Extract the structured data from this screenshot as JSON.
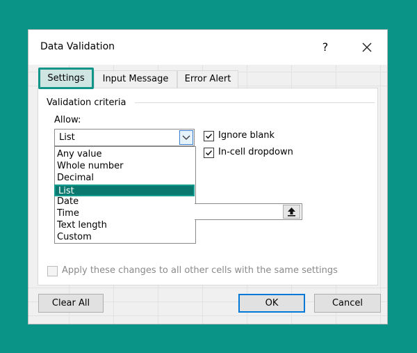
{
  "dialog": {
    "title": "Data Validation",
    "help": "?",
    "close_icon": "close-icon"
  },
  "tabs": [
    {
      "label": "Settings",
      "active": true
    },
    {
      "label": "Input Message",
      "active": false
    },
    {
      "label": "Error Alert",
      "active": false
    }
  ],
  "criteria": {
    "group_title": "Validation criteria",
    "allow_label": "Allow:",
    "allow_value": "List",
    "options": [
      "Any value",
      "Whole number",
      "Decimal",
      "List",
      "Date",
      "Time",
      "Text length",
      "Custom"
    ],
    "selected_option": "List",
    "ignore_blank": {
      "label": "Ignore blank",
      "checked": true
    },
    "in_cell_dropdown": {
      "label": "In-cell dropdown",
      "checked": true
    },
    "source_value": ""
  },
  "apply_all": {
    "label": "Apply these changes to all other cells with the same settings",
    "checked": false,
    "enabled": false
  },
  "buttons": {
    "clear_all": "Clear All",
    "ok": "OK",
    "cancel": "Cancel"
  },
  "colors": {
    "background": "#0a9488",
    "highlight": "#0b7870",
    "accent_border": "#119489"
  }
}
